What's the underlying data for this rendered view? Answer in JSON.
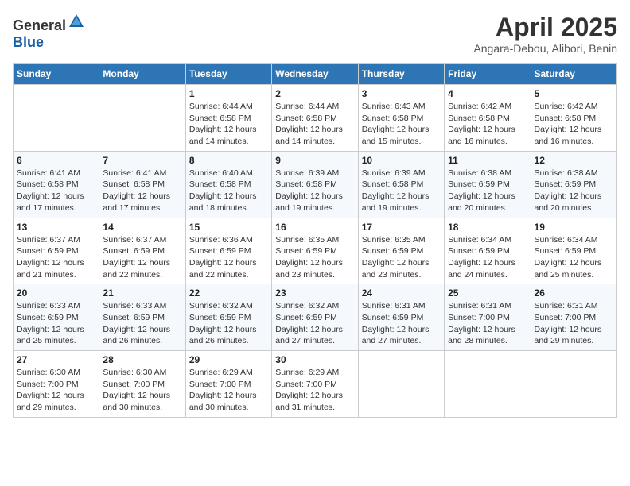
{
  "header": {
    "logo_general": "General",
    "logo_blue": "Blue",
    "title": "April 2025",
    "subtitle": "Angara-Debou, Alibori, Benin"
  },
  "weekdays": [
    "Sunday",
    "Monday",
    "Tuesday",
    "Wednesday",
    "Thursday",
    "Friday",
    "Saturday"
  ],
  "weeks": [
    [
      {
        "day": "",
        "sunrise": "",
        "sunset": "",
        "daylight": ""
      },
      {
        "day": "",
        "sunrise": "",
        "sunset": "",
        "daylight": ""
      },
      {
        "day": "1",
        "sunrise": "Sunrise: 6:44 AM",
        "sunset": "Sunset: 6:58 PM",
        "daylight": "Daylight: 12 hours and 14 minutes."
      },
      {
        "day": "2",
        "sunrise": "Sunrise: 6:44 AM",
        "sunset": "Sunset: 6:58 PM",
        "daylight": "Daylight: 12 hours and 14 minutes."
      },
      {
        "day": "3",
        "sunrise": "Sunrise: 6:43 AM",
        "sunset": "Sunset: 6:58 PM",
        "daylight": "Daylight: 12 hours and 15 minutes."
      },
      {
        "day": "4",
        "sunrise": "Sunrise: 6:42 AM",
        "sunset": "Sunset: 6:58 PM",
        "daylight": "Daylight: 12 hours and 16 minutes."
      },
      {
        "day": "5",
        "sunrise": "Sunrise: 6:42 AM",
        "sunset": "Sunset: 6:58 PM",
        "daylight": "Daylight: 12 hours and 16 minutes."
      }
    ],
    [
      {
        "day": "6",
        "sunrise": "Sunrise: 6:41 AM",
        "sunset": "Sunset: 6:58 PM",
        "daylight": "Daylight: 12 hours and 17 minutes."
      },
      {
        "day": "7",
        "sunrise": "Sunrise: 6:41 AM",
        "sunset": "Sunset: 6:58 PM",
        "daylight": "Daylight: 12 hours and 17 minutes."
      },
      {
        "day": "8",
        "sunrise": "Sunrise: 6:40 AM",
        "sunset": "Sunset: 6:58 PM",
        "daylight": "Daylight: 12 hours and 18 minutes."
      },
      {
        "day": "9",
        "sunrise": "Sunrise: 6:39 AM",
        "sunset": "Sunset: 6:58 PM",
        "daylight": "Daylight: 12 hours and 19 minutes."
      },
      {
        "day": "10",
        "sunrise": "Sunrise: 6:39 AM",
        "sunset": "Sunset: 6:58 PM",
        "daylight": "Daylight: 12 hours and 19 minutes."
      },
      {
        "day": "11",
        "sunrise": "Sunrise: 6:38 AM",
        "sunset": "Sunset: 6:59 PM",
        "daylight": "Daylight: 12 hours and 20 minutes."
      },
      {
        "day": "12",
        "sunrise": "Sunrise: 6:38 AM",
        "sunset": "Sunset: 6:59 PM",
        "daylight": "Daylight: 12 hours and 20 minutes."
      }
    ],
    [
      {
        "day": "13",
        "sunrise": "Sunrise: 6:37 AM",
        "sunset": "Sunset: 6:59 PM",
        "daylight": "Daylight: 12 hours and 21 minutes."
      },
      {
        "day": "14",
        "sunrise": "Sunrise: 6:37 AM",
        "sunset": "Sunset: 6:59 PM",
        "daylight": "Daylight: 12 hours and 22 minutes."
      },
      {
        "day": "15",
        "sunrise": "Sunrise: 6:36 AM",
        "sunset": "Sunset: 6:59 PM",
        "daylight": "Daylight: 12 hours and 22 minutes."
      },
      {
        "day": "16",
        "sunrise": "Sunrise: 6:35 AM",
        "sunset": "Sunset: 6:59 PM",
        "daylight": "Daylight: 12 hours and 23 minutes."
      },
      {
        "day": "17",
        "sunrise": "Sunrise: 6:35 AM",
        "sunset": "Sunset: 6:59 PM",
        "daylight": "Daylight: 12 hours and 23 minutes."
      },
      {
        "day": "18",
        "sunrise": "Sunrise: 6:34 AM",
        "sunset": "Sunset: 6:59 PM",
        "daylight": "Daylight: 12 hours and 24 minutes."
      },
      {
        "day": "19",
        "sunrise": "Sunrise: 6:34 AM",
        "sunset": "Sunset: 6:59 PM",
        "daylight": "Daylight: 12 hours and 25 minutes."
      }
    ],
    [
      {
        "day": "20",
        "sunrise": "Sunrise: 6:33 AM",
        "sunset": "Sunset: 6:59 PM",
        "daylight": "Daylight: 12 hours and 25 minutes."
      },
      {
        "day": "21",
        "sunrise": "Sunrise: 6:33 AM",
        "sunset": "Sunset: 6:59 PM",
        "daylight": "Daylight: 12 hours and 26 minutes."
      },
      {
        "day": "22",
        "sunrise": "Sunrise: 6:32 AM",
        "sunset": "Sunset: 6:59 PM",
        "daylight": "Daylight: 12 hours and 26 minutes."
      },
      {
        "day": "23",
        "sunrise": "Sunrise: 6:32 AM",
        "sunset": "Sunset: 6:59 PM",
        "daylight": "Daylight: 12 hours and 27 minutes."
      },
      {
        "day": "24",
        "sunrise": "Sunrise: 6:31 AM",
        "sunset": "Sunset: 6:59 PM",
        "daylight": "Daylight: 12 hours and 27 minutes."
      },
      {
        "day": "25",
        "sunrise": "Sunrise: 6:31 AM",
        "sunset": "Sunset: 7:00 PM",
        "daylight": "Daylight: 12 hours and 28 minutes."
      },
      {
        "day": "26",
        "sunrise": "Sunrise: 6:31 AM",
        "sunset": "Sunset: 7:00 PM",
        "daylight": "Daylight: 12 hours and 29 minutes."
      }
    ],
    [
      {
        "day": "27",
        "sunrise": "Sunrise: 6:30 AM",
        "sunset": "Sunset: 7:00 PM",
        "daylight": "Daylight: 12 hours and 29 minutes."
      },
      {
        "day": "28",
        "sunrise": "Sunrise: 6:30 AM",
        "sunset": "Sunset: 7:00 PM",
        "daylight": "Daylight: 12 hours and 30 minutes."
      },
      {
        "day": "29",
        "sunrise": "Sunrise: 6:29 AM",
        "sunset": "Sunset: 7:00 PM",
        "daylight": "Daylight: 12 hours and 30 minutes."
      },
      {
        "day": "30",
        "sunrise": "Sunrise: 6:29 AM",
        "sunset": "Sunset: 7:00 PM",
        "daylight": "Daylight: 12 hours and 31 minutes."
      },
      {
        "day": "",
        "sunrise": "",
        "sunset": "",
        "daylight": ""
      },
      {
        "day": "",
        "sunrise": "",
        "sunset": "",
        "daylight": ""
      },
      {
        "day": "",
        "sunrise": "",
        "sunset": "",
        "daylight": ""
      }
    ]
  ]
}
